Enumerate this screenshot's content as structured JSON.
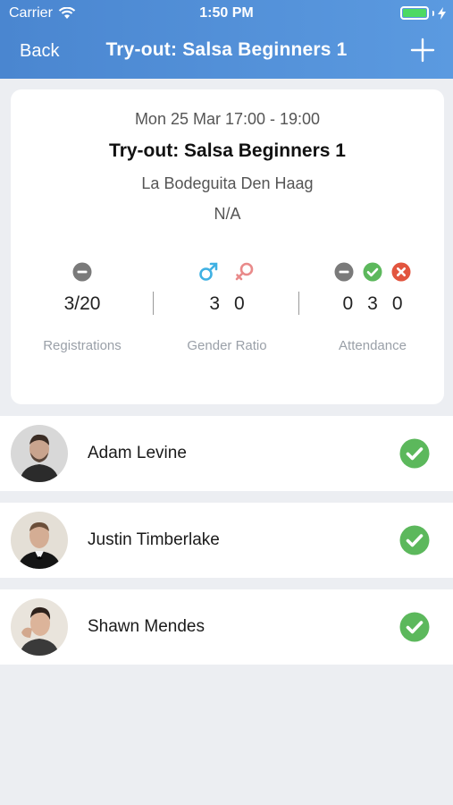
{
  "status_bar": {
    "carrier": "Carrier",
    "time": "1:50 PM"
  },
  "nav": {
    "back_label": "Back",
    "title": "Try-out: Salsa Beginners 1",
    "add_icon": "plus-icon"
  },
  "event": {
    "datetime": "Mon 25 Mar 17:00 - 19:00",
    "title": "Try-out: Salsa Beginners 1",
    "venue": "La Bodeguita Den Haag",
    "extra": "N/A"
  },
  "stats": {
    "registrations": {
      "value": "3/20",
      "label": "Registrations"
    },
    "gender": {
      "male": "3",
      "female": "0",
      "label": "Gender Ratio"
    },
    "attendance": {
      "unknown": "0",
      "present": "3",
      "absent": "0",
      "label": "Attendance"
    }
  },
  "participants": [
    {
      "name": "Adam Levine",
      "status": "present"
    },
    {
      "name": "Justin Timberlake",
      "status": "present"
    },
    {
      "name": "Shawn Mendes",
      "status": "present"
    }
  ],
  "colors": {
    "header": "#4a86d0",
    "male": "#3fb1e3",
    "female": "#e98a8a",
    "check": "#5cb85c",
    "absent": "#e2553f",
    "neutral": "#7a7a7a"
  }
}
